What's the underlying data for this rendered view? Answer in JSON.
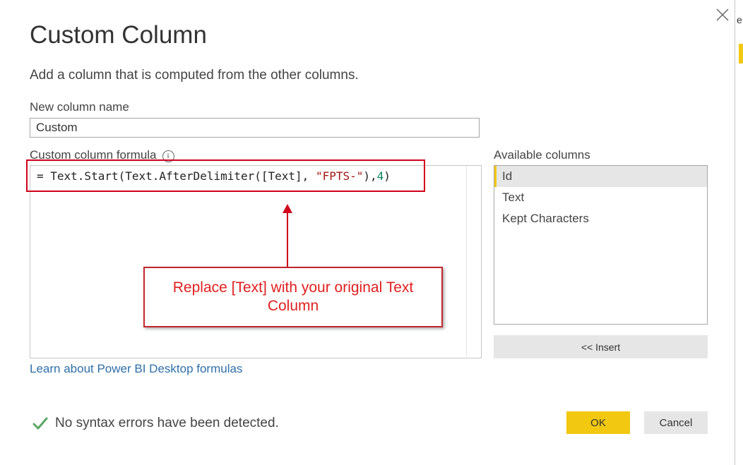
{
  "dialog": {
    "title": "Custom Column",
    "subtitle": "Add a column that is computed from the other columns."
  },
  "new_column": {
    "label": "New column name",
    "value": "Custom"
  },
  "formula": {
    "label": "Custom column formula",
    "info_icon": "info-icon",
    "prefix": "= Text.Start(Text.AfterDelimiter([Text], ",
    "string_literal": "\"FPTS-\"",
    "middle": "),",
    "number_literal": "4",
    "suffix": ")"
  },
  "annotation": {
    "text": "Replace [Text] with your original Text Column",
    "color": "#e02020"
  },
  "available_columns": {
    "label": "Available columns",
    "items": [
      "Id",
      "Text",
      "Kept Characters"
    ],
    "selected": "Id",
    "insert_label": "<< Insert"
  },
  "learn_link": "Learn about Power BI Desktop formulas",
  "status": {
    "icon": "checkmark-icon",
    "text": "No syntax errors have been detected."
  },
  "buttons": {
    "ok": "OK",
    "cancel": "Cancel"
  },
  "background_window": {
    "edge_char": "e"
  },
  "colors": {
    "accent": "#f2c811",
    "link": "#2f6fa7",
    "success": "#5aa764",
    "highlight_border": "#d0021b"
  }
}
